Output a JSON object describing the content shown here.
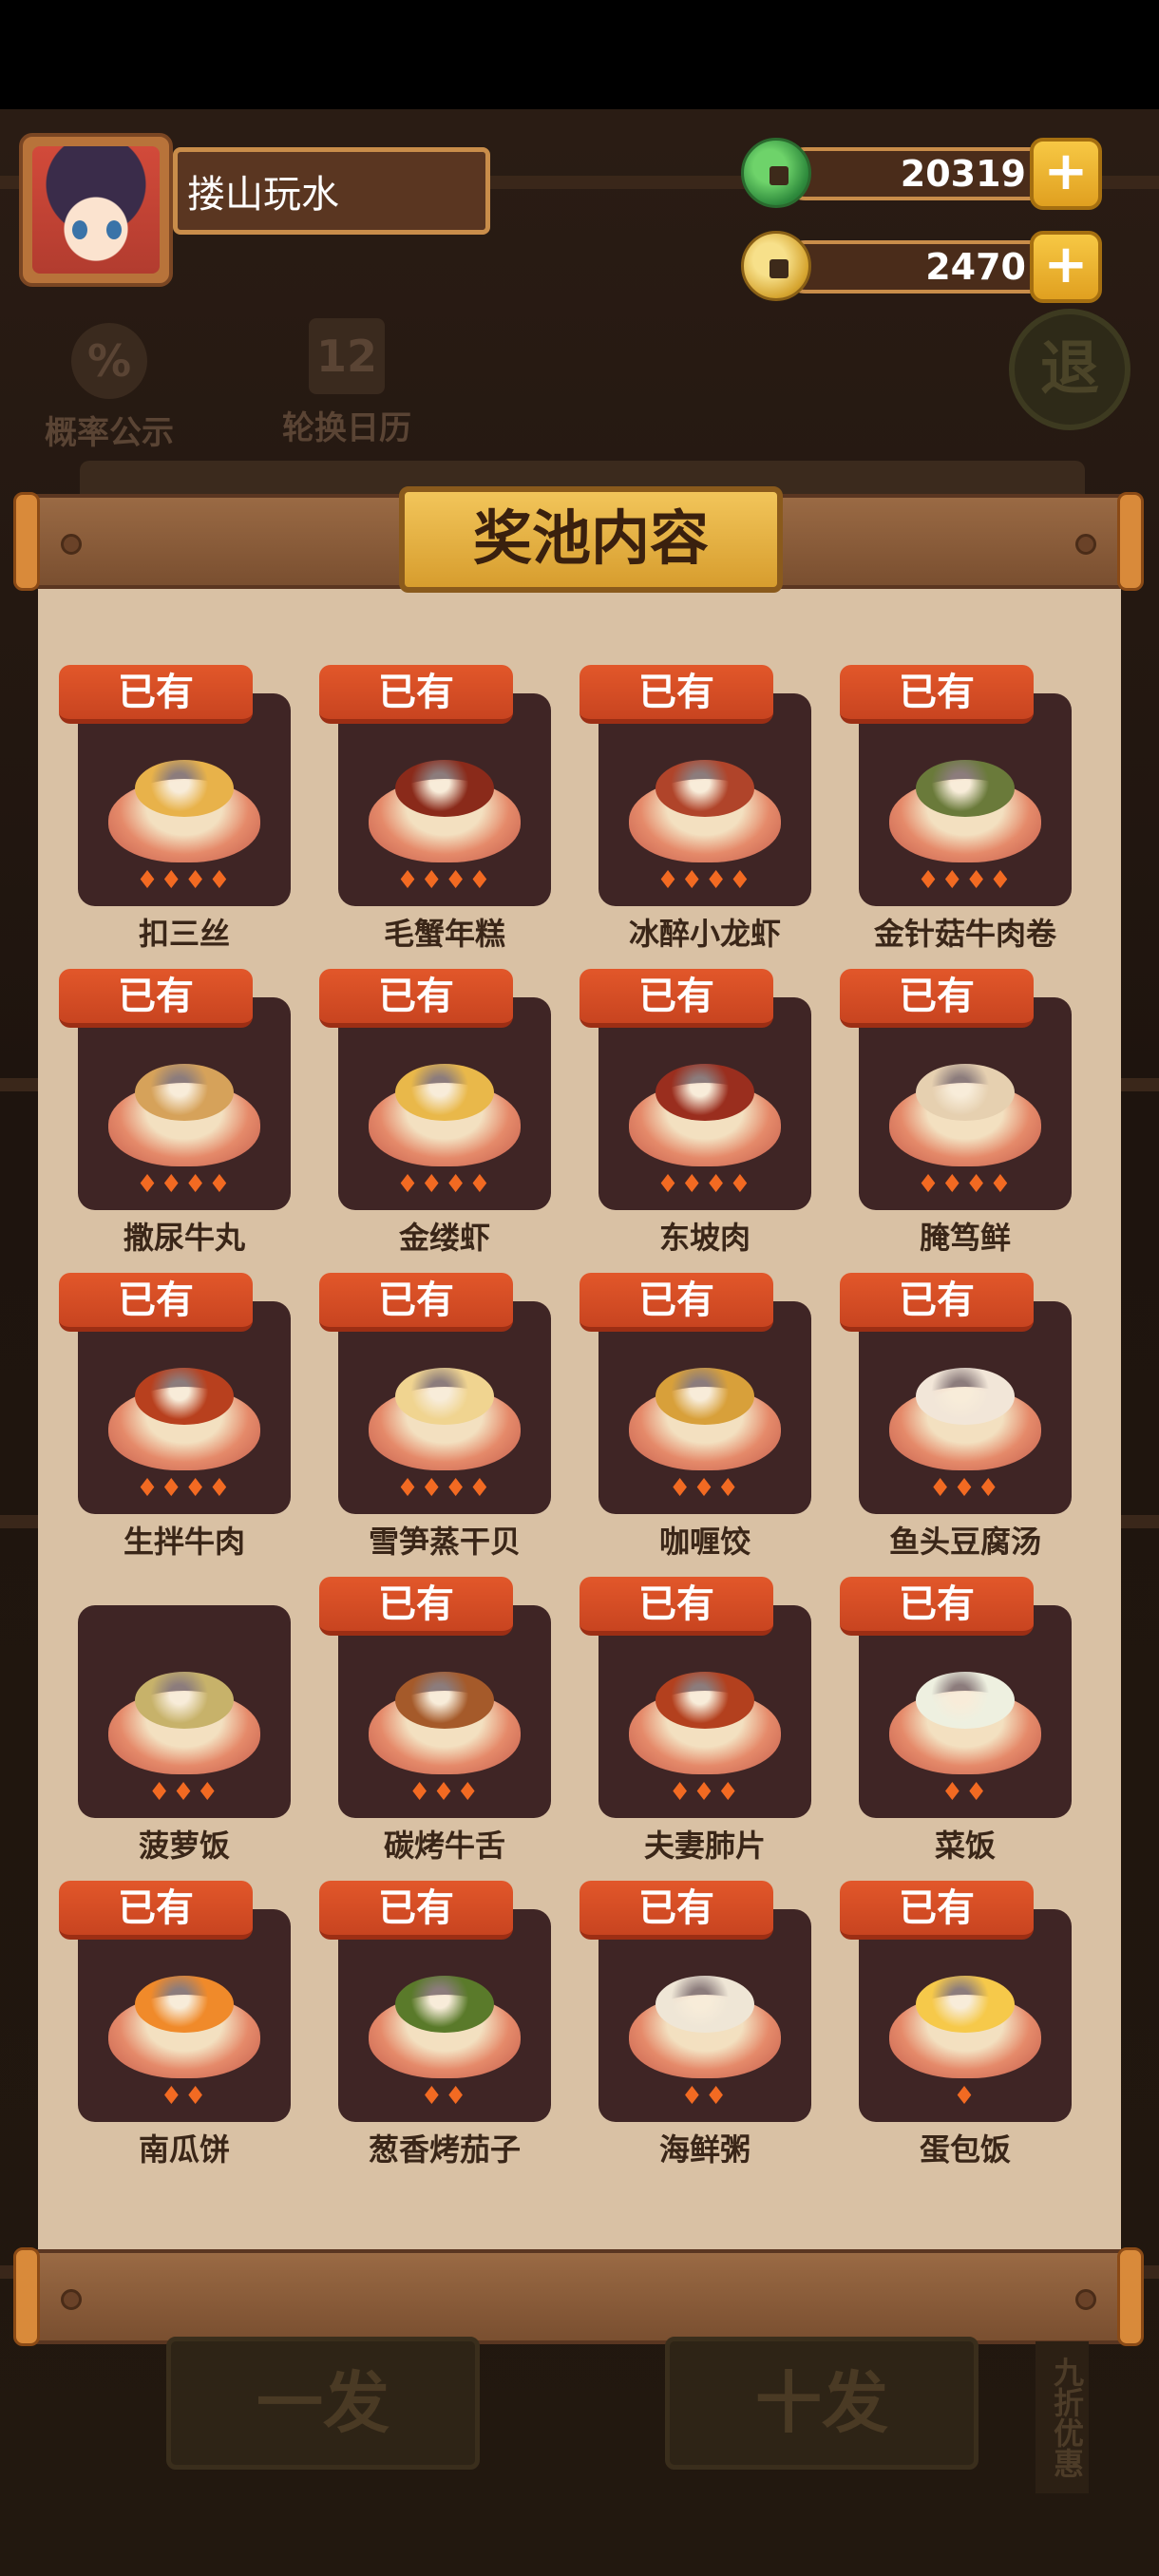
{
  "player": {
    "name": "搂山玩水"
  },
  "currencies": [
    {
      "name": "jade-coin",
      "value": "20319",
      "color": "#3a9a44"
    },
    {
      "name": "gold-coin",
      "value": "2470",
      "color": "#d6a530"
    }
  ],
  "plus_label": "+",
  "background": {
    "probability_label": "概率公示",
    "probability_icon": "%",
    "calendar_label": "轮换日历",
    "calendar_icon": "12",
    "exit_label": "退",
    "banner_text": "",
    "single_draw": "一发",
    "ten_draw": "十发",
    "discount": "九折优惠"
  },
  "panel": {
    "title": "奖池内容",
    "owned_label": "已有",
    "dishes": [
      {
        "name": "扣三丝",
        "owned": true,
        "stars": 4,
        "food_color": "#e8b24a"
      },
      {
        "name": "毛蟹年糕",
        "owned": true,
        "stars": 4,
        "food_color": "#8a2a1a"
      },
      {
        "name": "冰醉小龙虾",
        "owned": true,
        "stars": 4,
        "food_color": "#b0442a"
      },
      {
        "name": "金针菇牛肉卷",
        "owned": true,
        "stars": 4,
        "food_color": "#6a7a3a"
      },
      {
        "name": "撒尿牛丸",
        "owned": true,
        "stars": 4,
        "food_color": "#d6a25a"
      },
      {
        "name": "金缕虾",
        "owned": true,
        "stars": 4,
        "food_color": "#e9b84a"
      },
      {
        "name": "东坡肉",
        "owned": true,
        "stars": 4,
        "food_color": "#9a2e1e"
      },
      {
        "name": "腌笃鲜",
        "owned": true,
        "stars": 4,
        "food_color": "#e6d0b0"
      },
      {
        "name": "生拌牛肉",
        "owned": true,
        "stars": 4,
        "food_color": "#b8401e"
      },
      {
        "name": "雪笋蒸干贝",
        "owned": true,
        "stars": 4,
        "food_color": "#f0d490"
      },
      {
        "name": "咖喱饺",
        "owned": true,
        "stars": 3,
        "food_color": "#d8a03a"
      },
      {
        "name": "鱼头豆腐汤",
        "owned": true,
        "stars": 3,
        "food_color": "#f2e6d8"
      },
      {
        "name": "菠萝饭",
        "owned": false,
        "stars": 3,
        "food_color": "#c7b26a"
      },
      {
        "name": "碳烤牛舌",
        "owned": true,
        "stars": 3,
        "food_color": "#a55a2a"
      },
      {
        "name": "夫妻肺片",
        "owned": true,
        "stars": 3,
        "food_color": "#b3401e"
      },
      {
        "name": "菜饭",
        "owned": true,
        "stars": 2,
        "food_color": "#eef0e0"
      },
      {
        "name": "南瓜饼",
        "owned": true,
        "stars": 2,
        "food_color": "#f08a2a"
      },
      {
        "name": "葱香烤茄子",
        "owned": true,
        "stars": 2,
        "food_color": "#5a7a2a"
      },
      {
        "name": "海鲜粥",
        "owned": true,
        "stars": 2,
        "food_color": "#efe6d6"
      },
      {
        "name": "蛋包饭",
        "owned": true,
        "stars": 1,
        "food_color": "#f6c94a"
      }
    ]
  }
}
